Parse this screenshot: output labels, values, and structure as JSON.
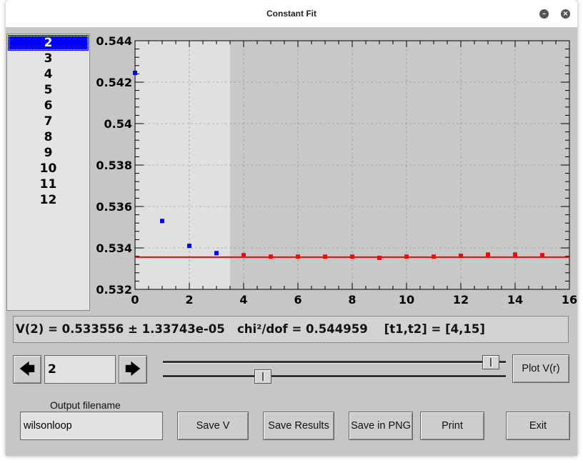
{
  "window": {
    "title": "Constant Fit",
    "minimize_glyph": "–",
    "close_glyph": "×"
  },
  "list": {
    "items": [
      "2",
      "3",
      "4",
      "5",
      "6",
      "7",
      "8",
      "9",
      "10",
      "11",
      "12"
    ],
    "selected": "2"
  },
  "chart_data": {
    "type": "scatter",
    "xlim": [
      0,
      16
    ],
    "ylim": [
      0.532,
      0.544
    ],
    "x_ticks": [
      "0",
      "2",
      "4",
      "6",
      "8",
      "10",
      "12",
      "14",
      "16"
    ],
    "y_ticks": [
      "0.532",
      "0.534",
      "0.536",
      "0.538",
      "0.54",
      "0.542",
      "0.544"
    ],
    "grid": true,
    "fit_range_shaded": [
      3.5,
      16
    ],
    "series": [
      {
        "color": "#0000ff",
        "x": [
          0,
          1,
          2,
          3
        ],
        "y": [
          0.54245,
          0.5353,
          0.5341,
          0.53375
        ]
      },
      {
        "color": "#ff0000",
        "x": [
          4,
          5,
          6,
          7,
          8,
          9,
          10,
          11,
          12,
          13,
          14,
          15
        ],
        "y": [
          0.53365,
          0.53358,
          0.53358,
          0.53358,
          0.53358,
          0.53352,
          0.53358,
          0.53358,
          0.53362,
          0.53368,
          0.53368,
          0.53365
        ]
      }
    ],
    "fit_line": {
      "y": 0.533556,
      "color": "#ff0000"
    }
  },
  "result": {
    "text": "V(2) = 0.533556 ± 1.33743e-05   chi²/dof = 0.544959    [t1,t2] = [4,15]"
  },
  "controls": {
    "left_arrow_icon": "left-arrow-icon",
    "right_arrow_icon": "right-arrow-icon",
    "left_glyph": "🡄",
    "right_glyph": "🡆",
    "spin_value": "2",
    "slider_top_level": 0.98,
    "slider_bottom_level": 0.28,
    "plot_button": "Plot V(r)"
  },
  "output": {
    "label": "Output filename",
    "filename": "wilsonloop"
  },
  "buttons": {
    "save_v": "Save V",
    "save_results": "Save Results",
    "save_png": "Save in PNG",
    "print": "Print",
    "exit": "Exit"
  }
}
